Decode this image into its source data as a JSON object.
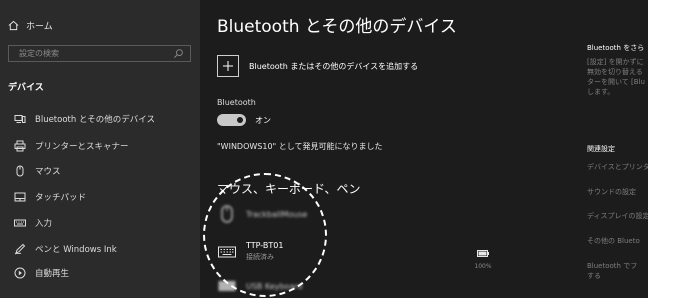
{
  "sidebar": {
    "home_label": "ホーム",
    "search_placeholder": "設定の検索",
    "section_label": "デバイス",
    "items": [
      {
        "label": "Bluetooth とその他のデバイス",
        "icon": "bluetooth-devices-icon"
      },
      {
        "label": "プリンターとスキャナー",
        "icon": "printer-icon"
      },
      {
        "label": "マウス",
        "icon": "mouse-icon"
      },
      {
        "label": "タッチパッド",
        "icon": "touchpad-icon"
      },
      {
        "label": "入力",
        "icon": "keyboard-icon"
      },
      {
        "label": "ペンと Windows Ink",
        "icon": "pen-icon"
      },
      {
        "label": "自動再生",
        "icon": "autoplay-icon"
      }
    ]
  },
  "main": {
    "title": "Bluetooth とその他のデバイス",
    "add_device_label": "Bluetooth またはその他のデバイスを追加する",
    "bluetooth_label": "Bluetooth",
    "toggle_label": "オン",
    "toggle_on": true,
    "discoverable_text": "\"WINDOWS10\" として発見可能になりました",
    "mouse_section_heading": "マウス、キーボード、ペン",
    "devices": [
      {
        "name": "TrackballMouse",
        "status": "",
        "icon": "mouse-icon",
        "blurred": true
      },
      {
        "name": "TTP-BT01",
        "status": "接続済み",
        "icon": "keyboard-icon",
        "blurred": false,
        "battery_percent": 100,
        "battery_text": "100%"
      },
      {
        "name": "USB Keyboard",
        "status": "",
        "icon": "keyboard-icon",
        "blurred": true
      }
    ]
  },
  "right_panel": {
    "heading": "Bluetooth をさら",
    "lines": [
      "[設定] を開かずに",
      "無効を切り替える",
      "ターを開いて [Blu",
      "します。"
    ],
    "related_heading": "関連設定",
    "links": [
      "デバイスとプリンタ",
      "サウンドの設定",
      "ディスプレイの設定",
      "その他の Blueto",
      "Bluetooth でフ",
      "する"
    ]
  },
  "colors": {
    "background": "#1c1c1c",
    "sidebar": "#2b2b2b",
    "text": "#ffffff",
    "muted": "#7e7e7e",
    "annotation_circle": "#ffffff"
  }
}
